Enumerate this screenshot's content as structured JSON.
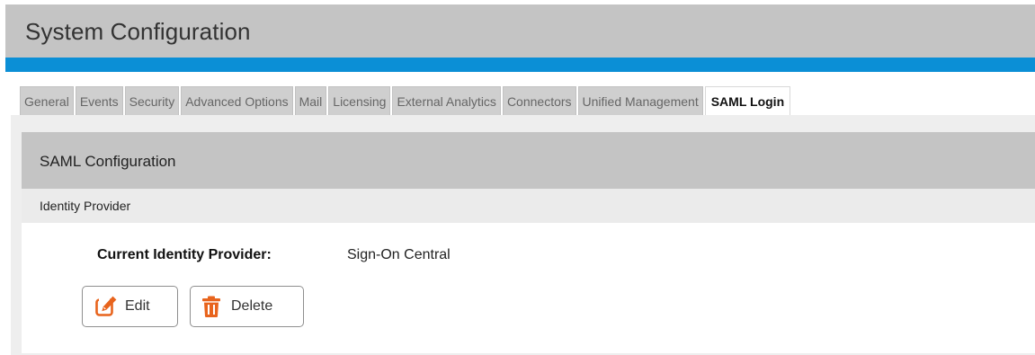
{
  "header": {
    "title": "System Configuration"
  },
  "tabs": [
    {
      "label": "General"
    },
    {
      "label": "Events"
    },
    {
      "label": "Security"
    },
    {
      "label": "Advanced Options"
    },
    {
      "label": "Mail"
    },
    {
      "label": "Licensing"
    },
    {
      "label": "External Analytics"
    },
    {
      "label": "Connectors"
    },
    {
      "label": "Unified Management"
    },
    {
      "label": "SAML Login",
      "active": true
    }
  ],
  "section": {
    "title": "SAML Configuration",
    "subtitle": "Identity Provider"
  },
  "identity": {
    "label": "Current Identity Provider:",
    "value": "Sign-On Central"
  },
  "buttons": {
    "edit": {
      "label": "Edit",
      "icon": "edit-icon"
    },
    "delete": {
      "label": "Delete",
      "icon": "trash-icon"
    }
  },
  "colors": {
    "accent": "#0b8fd6",
    "icon": "#e8641d"
  }
}
